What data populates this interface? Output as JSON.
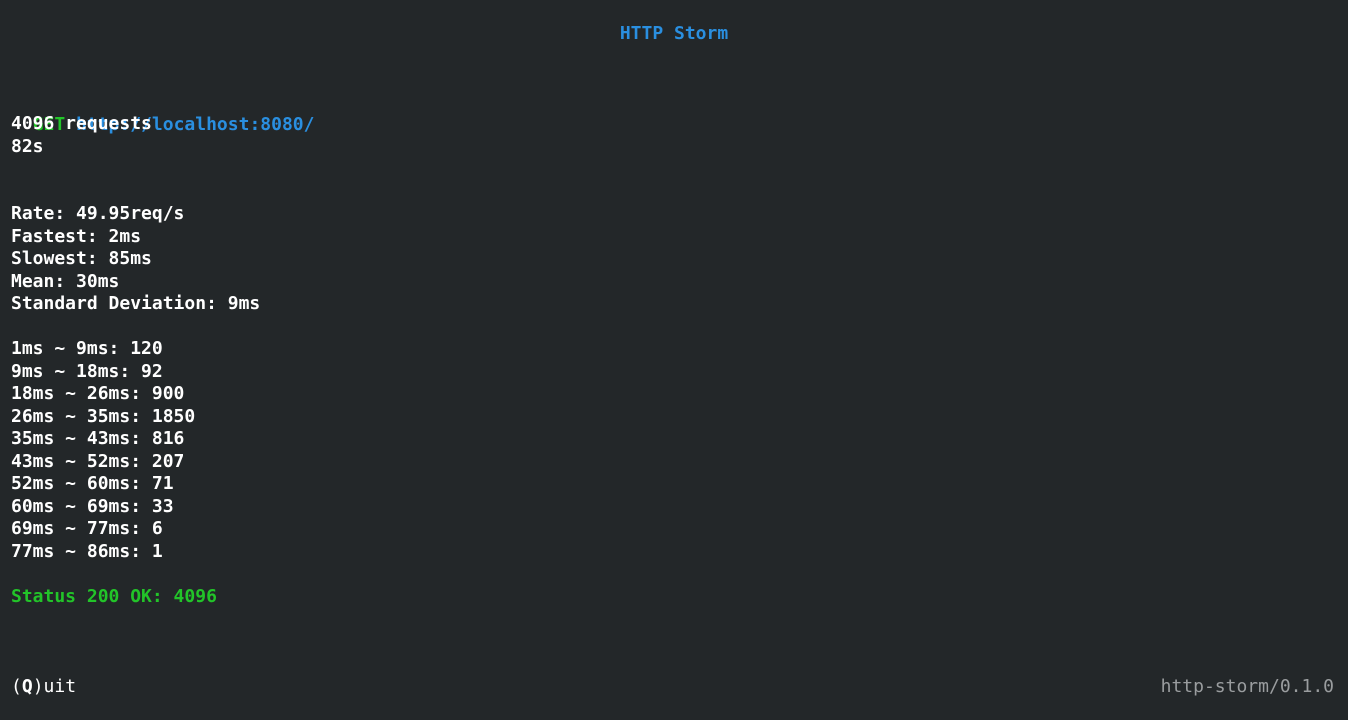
{
  "app": {
    "title": "HTTP Storm",
    "version": "http-storm/0.1.0"
  },
  "request": {
    "method": "GET",
    "url": "http://localhost:8080/",
    "count_text": "4096 requests",
    "duration": "82s"
  },
  "stats": {
    "rate": "Rate: 49.95req/s",
    "fastest": "Fastest: 2ms",
    "slowest": "Slowest: 85ms",
    "mean": "Mean: 30ms",
    "std_dev": "Standard Deviation: 9ms"
  },
  "histogram": [
    "1ms ~ 9ms: 120",
    "9ms ~ 18ms: 92",
    "18ms ~ 26ms: 900",
    "26ms ~ 35ms: 1850",
    "35ms ~ 43ms: 816",
    "43ms ~ 52ms: 207",
    "52ms ~ 60ms: 71",
    "60ms ~ 69ms: 33",
    "69ms ~ 77ms: 6",
    "77ms ~ 86ms: 1"
  ],
  "status": {
    "text": "Status 200 OK: 4096"
  },
  "footer": {
    "quit_open": "(",
    "quit_key": "Q",
    "quit_rest": ")uit"
  },
  "colors": {
    "background": "#232729",
    "accent_blue": "#2a8fe0",
    "success_green": "#22c429",
    "muted": "#9a9d9f"
  }
}
